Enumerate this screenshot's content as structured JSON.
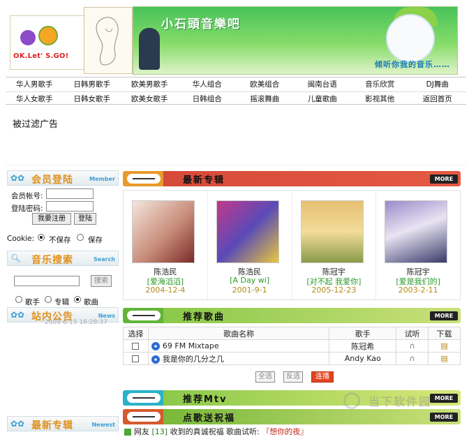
{
  "banner": {
    "logo_text": "OK.Let' S.GO!",
    "title": "小石頭音樂吧",
    "slogan": "倾听你我的音乐……"
  },
  "nav": {
    "row1": [
      "华人男歌手",
      "日韩男歌手",
      "欧美男歌手",
      "华人组合",
      "欧美组合",
      "闽南台语",
      "音乐欣赏",
      "DJ舞曲"
    ],
    "row2": [
      "华人女歌手",
      "日韩女歌手",
      "欧美女歌手",
      "日韩组合",
      "摇滚舞曲",
      "儿童歌曲",
      "影视其他",
      "返回首页"
    ]
  },
  "ad_notice": "被过滤广告",
  "login": {
    "heading": "会员登陆",
    "heading_en": "Member",
    "account_label": "会员帐号:",
    "password_label": "登陆密码:",
    "register_button": "我要注册",
    "login_button": "登陆",
    "cookie_label": "Cookie:",
    "opt_no_save": "不保存",
    "opt_save": "保存"
  },
  "search": {
    "heading": "音乐搜索",
    "heading_en": "Search",
    "button": "搜索",
    "opt_singer": "歌手",
    "opt_album": "专辑",
    "opt_song": "歌曲"
  },
  "notice": {
    "heading": "站内公告",
    "heading_en": "News",
    "partial_text": "2008-6-15 16:28:37"
  },
  "newest_side": {
    "heading": "最新专辑",
    "heading_en": "Newest"
  },
  "sections": {
    "albums": "最新专辑",
    "songs": "推荐歌曲",
    "mtv": "推荐Mtv",
    "dedicate": "点歌送祝福",
    "more": "MORE"
  },
  "albums": [
    {
      "artist": "陈浩民",
      "name": "[爱海滔滔]",
      "date": "2004-12-4"
    },
    {
      "artist": "陈浩民",
      "name": "[A Day wi]",
      "date": "2001-9-1"
    },
    {
      "artist": "陈冠宇",
      "name": "[对不起 我爱你]",
      "date": "2005-12-23"
    },
    {
      "artist": "陈冠宇",
      "name": "[爱是我们的]",
      "date": "2003-2-11"
    }
  ],
  "songs_table": {
    "headers": [
      "选择",
      "歌曲名称",
      "歌手",
      "试听",
      "下载"
    ],
    "rows": [
      {
        "title": "69 FM Mixtape",
        "artist": "陈冠希"
      },
      {
        "title": "我是你的几分之几",
        "artist": "Andy Kao"
      }
    ],
    "btn_select_all": "全选",
    "btn_invert": "反选",
    "btn_play": "连播"
  },
  "dedication": {
    "prefix": "网友",
    "count": "[13]",
    "text": "收到的真诚祝福",
    "song_label": "歌曲试听:",
    "song": "『想你的夜』"
  },
  "watermark": "当下软件园",
  "colors": {
    "orange_bar": "#e89a2a",
    "green_bar": "#62b53a",
    "cyan_bar": "#2ab3c8",
    "red_bar": "#d65a2e",
    "play_btn": "#e0441e"
  }
}
